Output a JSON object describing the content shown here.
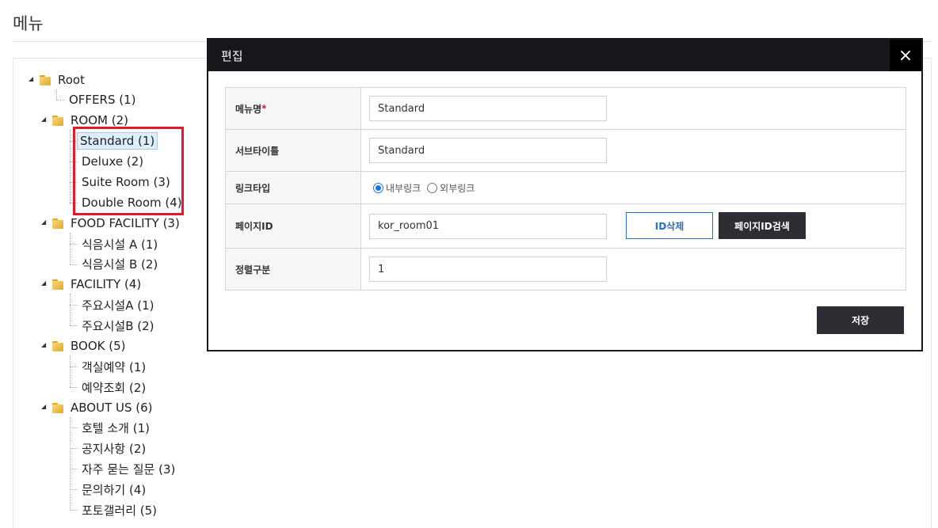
{
  "page": {
    "title": "메뉴"
  },
  "tree": {
    "root": "Root",
    "items": [
      {
        "label": "OFFERS (1)"
      },
      {
        "label": "ROOM (2)",
        "children": [
          {
            "label": "Standard (1)",
            "selected": true
          },
          {
            "label": "Deluxe (2)"
          },
          {
            "label": "Suite Room (3)"
          },
          {
            "label": "Double Room (4)"
          }
        ]
      },
      {
        "label": "FOOD FACILITY (3)",
        "children": [
          {
            "label": "식음시설 A (1)"
          },
          {
            "label": "식음시설 B (2)"
          }
        ]
      },
      {
        "label": "FACILITY (4)",
        "children": [
          {
            "label": "주요시설A (1)"
          },
          {
            "label": "주요시설B (2)"
          }
        ]
      },
      {
        "label": "BOOK (5)",
        "children": [
          {
            "label": "객실예약 (1)"
          },
          {
            "label": "예약조회 (2)"
          }
        ]
      },
      {
        "label": "ABOUT US (6)",
        "children": [
          {
            "label": "호텔 소개 (1)"
          },
          {
            "label": "공지사항 (2)"
          },
          {
            "label": "자주 묻는 질문 (3)"
          },
          {
            "label": "문의하기 (4)"
          },
          {
            "label": "포토갤러리 (5)"
          }
        ]
      }
    ]
  },
  "modal": {
    "title": "편집",
    "close_icon": "×",
    "fields": {
      "menu_name_label": "메뉴명",
      "menu_name_required": "*",
      "menu_name_value": "Standard",
      "subtitle_label": "서브타이틀",
      "subtitle_value": "Standard",
      "link_type_label": "링크타입",
      "link_internal": "내부링크",
      "link_external": "외부링크",
      "link_selected": "internal",
      "page_id_label": "페이지ID",
      "page_id_value": "kor_room01",
      "delete_id_button": "ID삭제",
      "search_page_id_button": "페이지ID검색",
      "sort_label": "정렬구분",
      "sort_value": "1"
    },
    "save_button": "저장"
  },
  "colors": {
    "highlight": "#e0192b",
    "modal_header": "#16181c",
    "accent_blue": "#2a6fbd"
  }
}
